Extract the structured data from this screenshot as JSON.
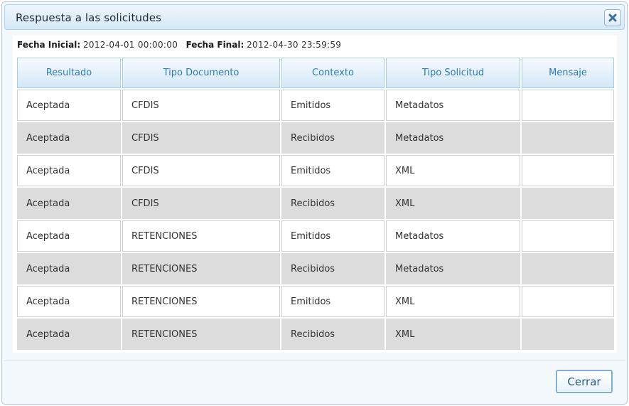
{
  "dialog": {
    "title": "Respuesta a las solicitudes",
    "close_icon": "close-x-icon"
  },
  "dates": {
    "start_label": "Fecha Inicial",
    "start_value": "2012-04-01 00:00:00",
    "end_label": "Fecha Final",
    "end_value": "2012-04-30 23:59:59"
  },
  "table": {
    "headers": [
      "Resultado",
      "Tipo Documento",
      "Contexto",
      "Tipo Solicitud",
      "Mensaje"
    ],
    "rows": [
      [
        "Aceptada",
        "CFDIS",
        "Emitidos",
        "Metadatos",
        ""
      ],
      [
        "Aceptada",
        "CFDIS",
        "Recibidos",
        "Metadatos",
        ""
      ],
      [
        "Aceptada",
        "CFDIS",
        "Emitidos",
        "XML",
        ""
      ],
      [
        "Aceptada",
        "CFDIS",
        "Recibidos",
        "XML",
        ""
      ],
      [
        "Aceptada",
        "RETENCIONES",
        "Emitidos",
        "Metadatos",
        ""
      ],
      [
        "Aceptada",
        "RETENCIONES",
        "Recibidos",
        "Metadatos",
        ""
      ],
      [
        "Aceptada",
        "RETENCIONES",
        "Emitidos",
        "XML",
        ""
      ],
      [
        "Aceptada",
        "RETENCIONES",
        "Recibidos",
        "XML",
        ""
      ]
    ]
  },
  "footer": {
    "close_label": "Cerrar"
  },
  "colors": {
    "header_text": "#2e7ab8",
    "alt_row": "#dcdcdc",
    "close_icon": "#3a6fa3"
  }
}
